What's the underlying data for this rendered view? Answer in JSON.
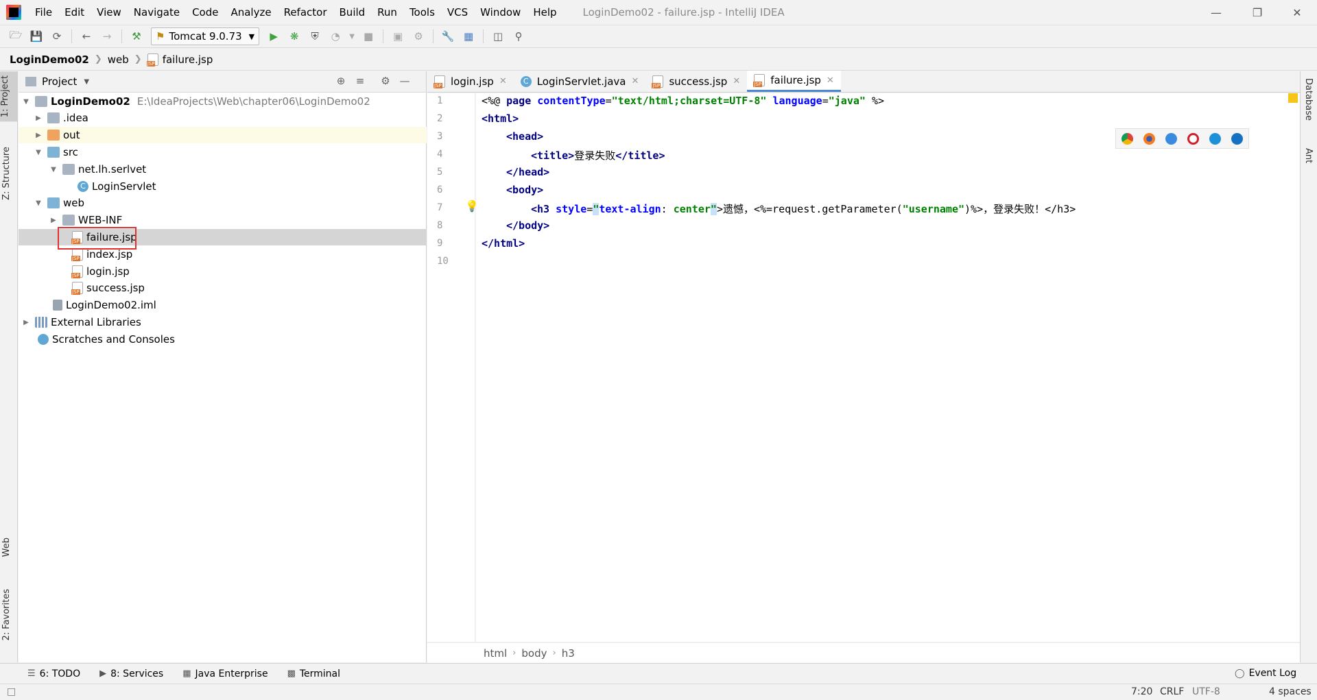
{
  "menubar": {
    "items": [
      "File",
      "Edit",
      "View",
      "Navigate",
      "Code",
      "Analyze",
      "Refactor",
      "Build",
      "Run",
      "Tools",
      "VCS",
      "Window",
      "Help"
    ],
    "window_title": "LoginDemo02 - failure.jsp - IntelliJ IDEA"
  },
  "toolbar": {
    "run_config": "Tomcat 9.0.73"
  },
  "navbar": {
    "crumbs": [
      "LoginDemo02",
      "web",
      "failure.jsp"
    ]
  },
  "left_stripe": {
    "project": "1: Project",
    "structure": "Z: Structure",
    "web": "Web",
    "favorites": "2: Favorites"
  },
  "right_stripe": {
    "database": "Database",
    "ant": "Ant"
  },
  "project_panel": {
    "title": "Project",
    "tree": [
      {
        "label": "LoginDemo02",
        "extra": "E:\\IdeaProjects\\Web\\chapter06\\LoginDemo02"
      },
      {
        "label": ".idea"
      },
      {
        "label": "out"
      },
      {
        "label": "src"
      },
      {
        "label": "net.lh.serlvet"
      },
      {
        "label": "LoginServlet"
      },
      {
        "label": "web"
      },
      {
        "label": "WEB-INF"
      },
      {
        "label": "failure.jsp"
      },
      {
        "label": "index.jsp"
      },
      {
        "label": "login.jsp"
      },
      {
        "label": "success.jsp"
      },
      {
        "label": "LoginDemo02.iml"
      },
      {
        "label": "External Libraries"
      },
      {
        "label": "Scratches and Consoles"
      }
    ]
  },
  "editor": {
    "tabs": [
      "login.jsp",
      "LoginServlet.java",
      "success.jsp",
      "failure.jsp"
    ],
    "line_numbers": [
      "1",
      "2",
      "3",
      "4",
      "5",
      "6",
      "7",
      "8",
      "9",
      "10"
    ],
    "code": {
      "l1_a": "<%@ ",
      "l1_b": "page ",
      "l1_c": "contentType",
      "l1_d": "=",
      "l1_e": "\"text/html;charset=UTF-8\"",
      "l1_f": " language",
      "l1_g": "=",
      "l1_h": "\"java\"",
      "l1_i": " %>",
      "l2": "<html>",
      "l3": "<head>",
      "l4_a": "<title>",
      "l4_b": "登录失败",
      "l4_c": "</title>",
      "l5": "</head>",
      "l6": "<body>",
      "l7_a": "<h3 ",
      "l7_b": "style",
      "l7_c": "=",
      "l7_d": "\"",
      "l7_e": "text-align",
      "l7_f": ": ",
      "l7_g": "center",
      "l7_h": "\"",
      "l7_i": ">遗憾，<%=request.getParameter(",
      "l7_j": "\"username\"",
      "l7_k": ")%>，登录失败！</h3>",
      "l8": "</body>",
      "l9": "</html>"
    },
    "breadcrumbs": [
      "html",
      "body",
      "h3"
    ]
  },
  "bottom_bar": {
    "todo": "6: TODO",
    "services": "8: Services",
    "java_enterprise": "Java Enterprise",
    "terminal": "Terminal",
    "event_log": "Event Log"
  },
  "status_bar": {
    "position": "7:20",
    "line_sep": "CRLF",
    "encoding": "UTF-8",
    "indent": "4 spaces"
  }
}
